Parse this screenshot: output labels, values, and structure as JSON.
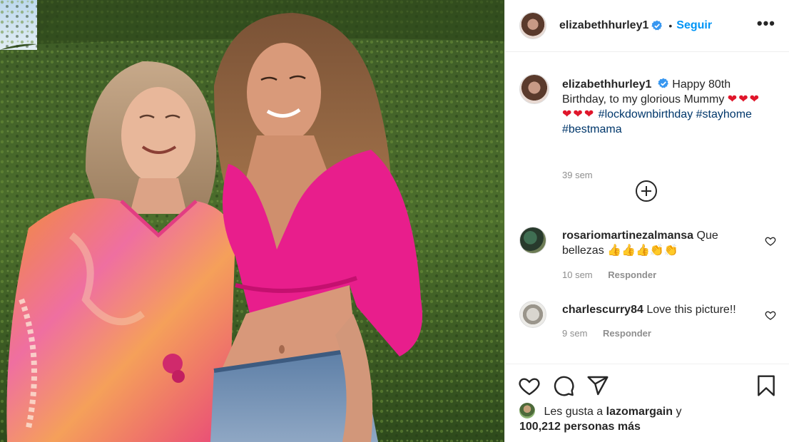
{
  "post": {
    "username": "elizabethhurley1",
    "separator": "•",
    "follow_label": "Seguir",
    "more_label": "•••"
  },
  "caption": {
    "username": "elizabethhurley1",
    "text_1": "Happy 80th Birthday, to my glorious Mummy",
    "hearts": "❤❤❤❤❤❤",
    "tag_1": "#lockdownbirthday",
    "tag_2": "#stayhome",
    "tag_3": "#bestmama",
    "time": "39 sem"
  },
  "comments": [
    {
      "username": "rosariomartinezalmansa",
      "text": "Que bellezas 👍👍👍👏👏",
      "time": "10 sem",
      "reply_label": "Responder"
    },
    {
      "username": "charlescurry84",
      "text": "Love this picture!!",
      "time": "9 sem",
      "reply_label": "Responder"
    }
  ],
  "likes": {
    "prefix": "Les gusta a",
    "user": "lazomargain",
    "and": "y",
    "count": "100,212 personas más"
  },
  "icons": {
    "verified": "verified-badge-icon",
    "more": "more-options-icon",
    "add": "load-more-comments-icon",
    "like": "heart-icon",
    "comment": "comment-icon",
    "share": "share-icon",
    "save": "bookmark-icon"
  },
  "colors": {
    "accent": "#0095f6",
    "hashtag": "#00376b",
    "muted": "#8e8e8e",
    "text": "#262626",
    "heart": "#e0162b"
  }
}
